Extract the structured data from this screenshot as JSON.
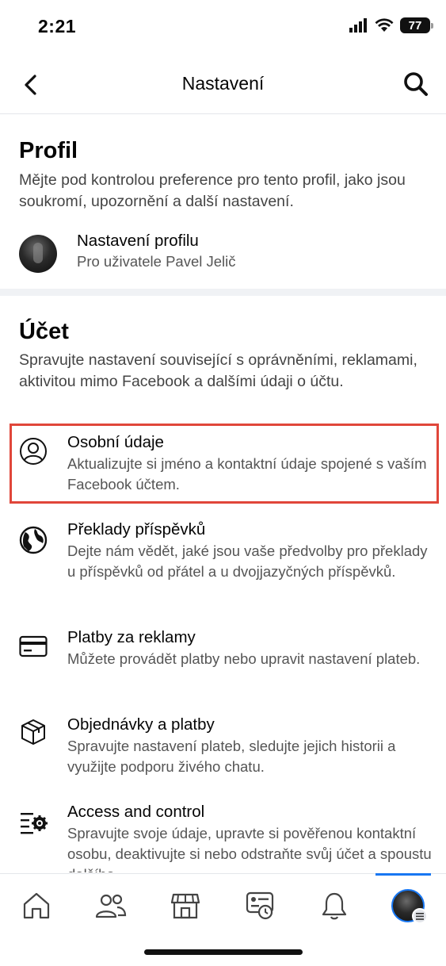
{
  "status": {
    "time": "2:21",
    "battery": "77"
  },
  "nav": {
    "title": "Nastavení"
  },
  "profile_section": {
    "title": "Profil",
    "description": "Mějte pod kontrolou preference pro tento profil, jako jsou soukromí, upozornění a další nastavení.",
    "item": {
      "title": "Nastavení profilu",
      "subtitle": "Pro uživatele Pavel Jelič"
    }
  },
  "account_section": {
    "title": "Účet",
    "description": "Spravujte nastavení související s oprávněními, reklamami, aktivitou mimo Facebook a dalšími údaji o účtu.",
    "items": [
      {
        "icon": "person-circle-icon",
        "title": "Osobní údaje",
        "description": "Aktualizujte si jméno a kontaktní údaje spojené s vaším Facebook účtem."
      },
      {
        "icon": "globe-icon",
        "title": "Překlady příspěvků",
        "description": "Dejte nám vědět, jaké jsou vaše předvolby pro překlady u příspěvků od přátel a u dvojjazyčných příspěvků."
      },
      {
        "icon": "credit-card-icon",
        "title": "Platby za reklamy",
        "description": "Můžete provádět platby nebo upravit nastavení plateb."
      },
      {
        "icon": "package-icon",
        "title": "Objednávky a platby",
        "description": "Spravujte nastavení plateb, sledujte jejich historii a využijte podporu živého chatu."
      },
      {
        "icon": "settings-list-icon",
        "title": "Access and control",
        "description": "Spravujte svoje údaje, upravte si pověřenou kontaktní osobu, deaktivujte si nebo odstraňte svůj účet a spoustu dalšího."
      }
    ]
  },
  "tabbar": {
    "tabs": [
      "home-icon",
      "friends-icon",
      "marketplace-icon",
      "memories-icon",
      "notifications-icon",
      "profile-menu"
    ],
    "active": "profile-menu"
  },
  "colors": {
    "accent": "#1877f2",
    "highlight": "#e0463a"
  }
}
